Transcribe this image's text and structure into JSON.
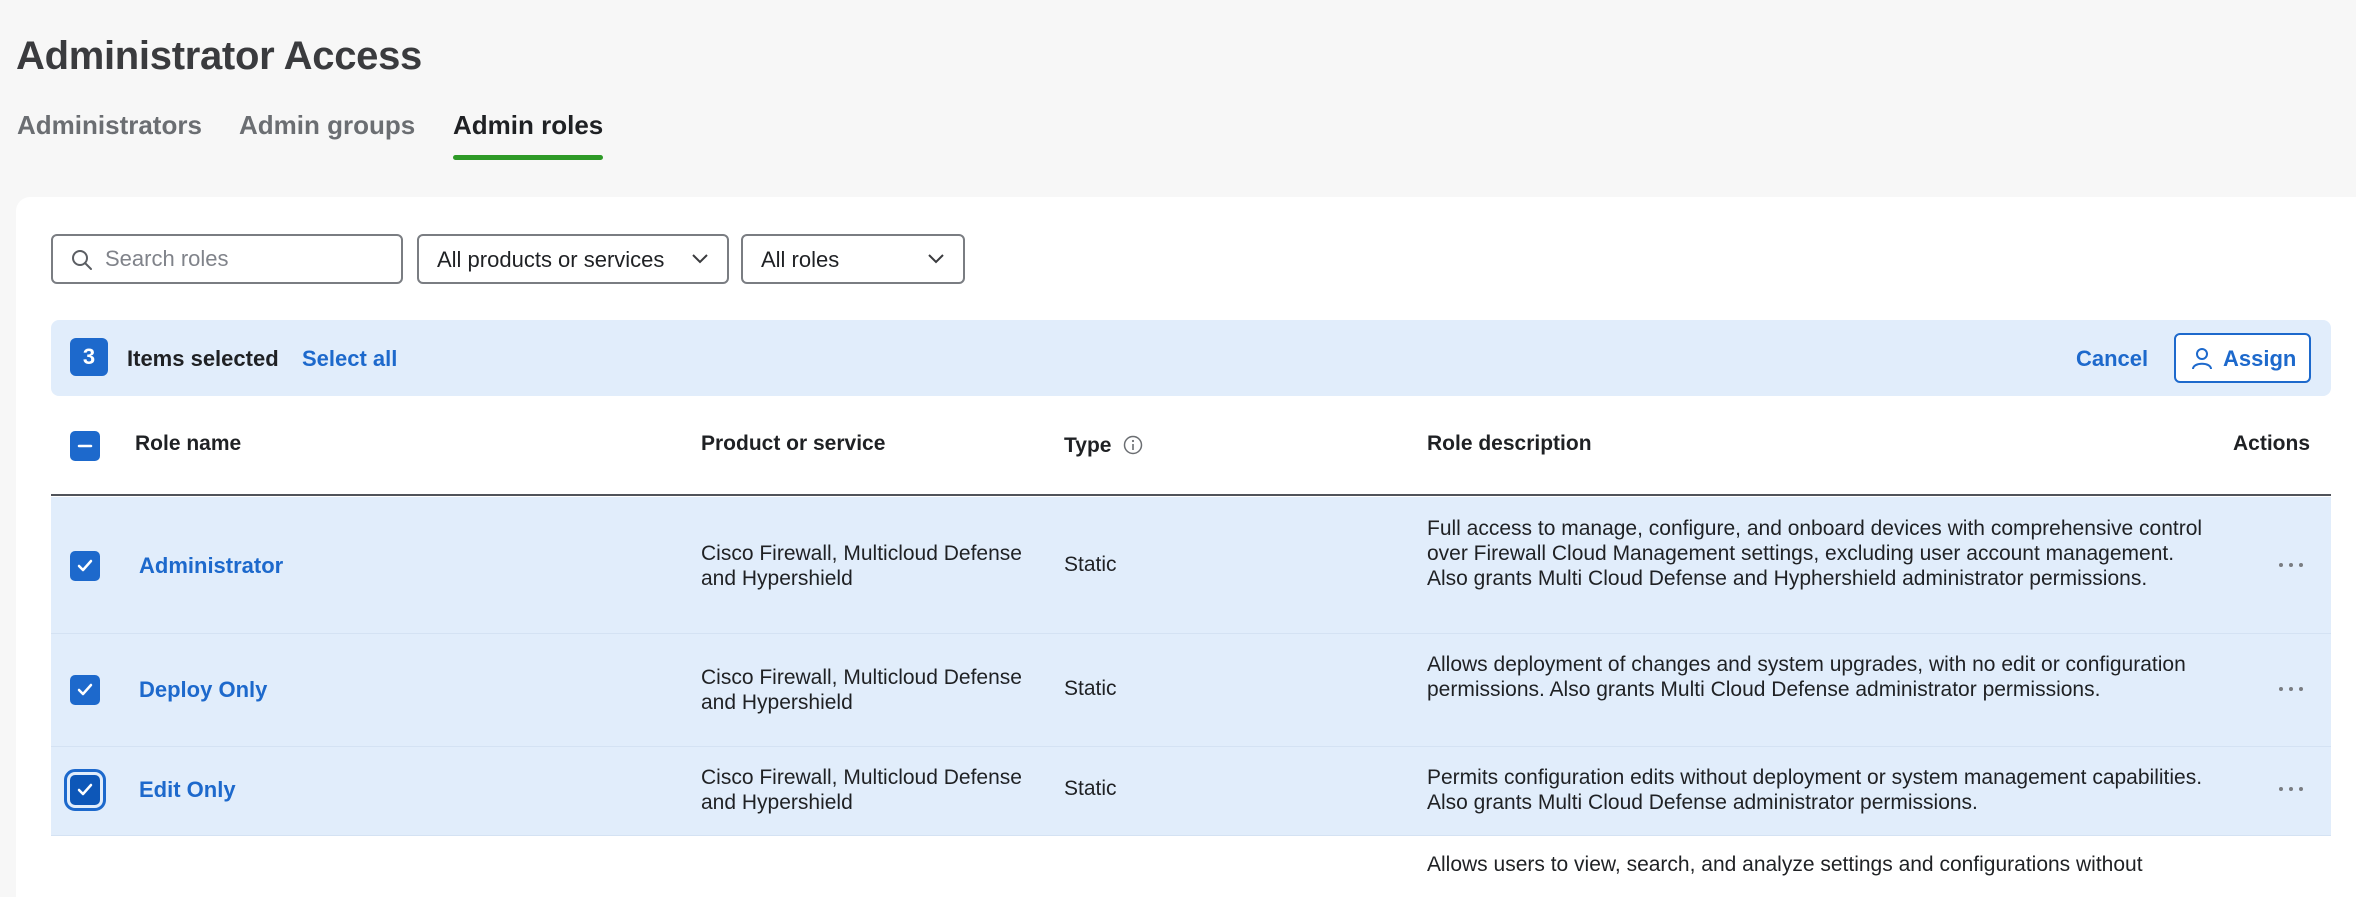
{
  "page": {
    "title": "Administrator Access"
  },
  "tabs": [
    {
      "label": "Administrators",
      "active": false
    },
    {
      "label": "Admin groups",
      "active": false
    },
    {
      "label": "Admin roles",
      "active": true
    }
  ],
  "filters": {
    "search_placeholder": "Search roles",
    "product_filter": "All products or services",
    "role_filter": "All roles"
  },
  "selection": {
    "count": "3",
    "label": "Items selected",
    "select_all": "Select all",
    "cancel": "Cancel",
    "assign": "Assign"
  },
  "table": {
    "headers": {
      "role_name": "Role name",
      "product": "Product or service",
      "type": "Type",
      "description": "Role description",
      "actions": "Actions"
    },
    "rows": [
      {
        "name": "Administrator",
        "product": "Cisco Firewall, Multicloud Defense and Hypershield",
        "type": "Static",
        "description": "Full access to manage, configure, and onboard devices with comprehensive control over Firewall Cloud Management settings, excluding user account management. Also grants Multi Cloud Defense and Hyphershield administrator permissions.",
        "checked": true
      },
      {
        "name": "Deploy Only",
        "product": "Cisco Firewall, Multicloud Defense and Hypershield",
        "type": "Static",
        "description": "Allows deployment of changes and system upgrades, with no edit or configuration permissions. Also grants Multi Cloud Defense administrator permissions.",
        "checked": true
      },
      {
        "name": "Edit Only",
        "product": "Cisco Firewall, Multicloud Defense and Hypershield",
        "type": "Static",
        "description": "Permits configuration edits without deployment or system management capabilities. Also grants Multi Cloud Defense administrator permissions.",
        "checked": true
      }
    ],
    "partial_row_description": "Allows users to view, search, and analyze settings and configurations without"
  },
  "colors": {
    "accent": "#1d69cc",
    "tab_underline": "#2e9a27",
    "selection_bg": "#e1edfb"
  }
}
